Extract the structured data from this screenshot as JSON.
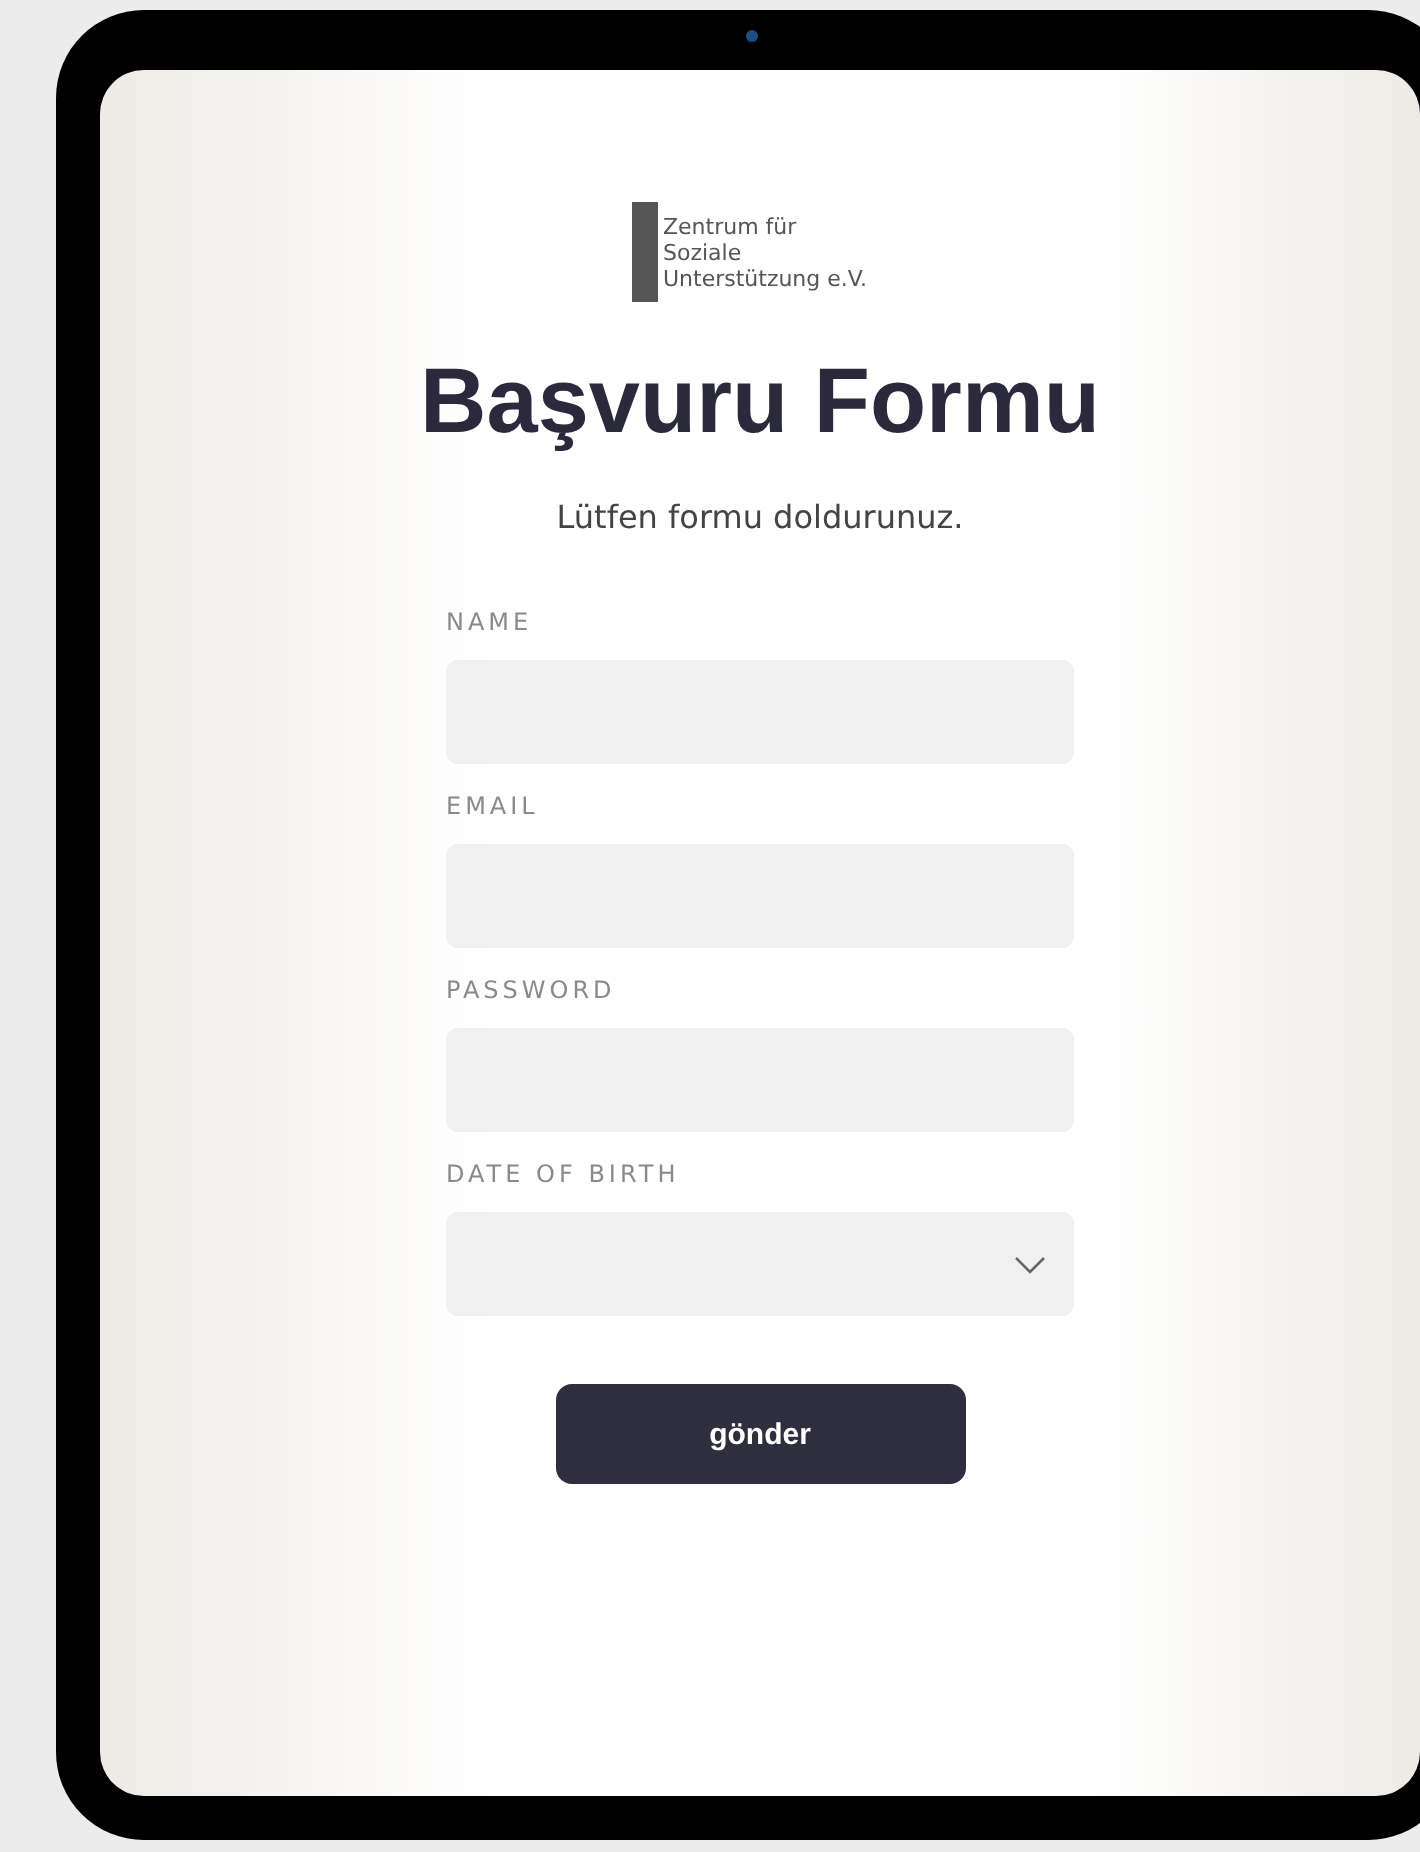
{
  "logo": {
    "lines": [
      "Zentrum für",
      "Soziale",
      "Unterstützung e.V."
    ]
  },
  "title": "Başvuru Formu",
  "subtitle": "Lütfen formu doldurunuz.",
  "fields": [
    {
      "label": "NAME",
      "kind": "text"
    },
    {
      "label": "EMAIL",
      "kind": "text"
    },
    {
      "label": "PASSWORD",
      "kind": "text"
    },
    {
      "label": "DATE OF BIRTH",
      "kind": "select"
    }
  ],
  "submit": "gönder"
}
